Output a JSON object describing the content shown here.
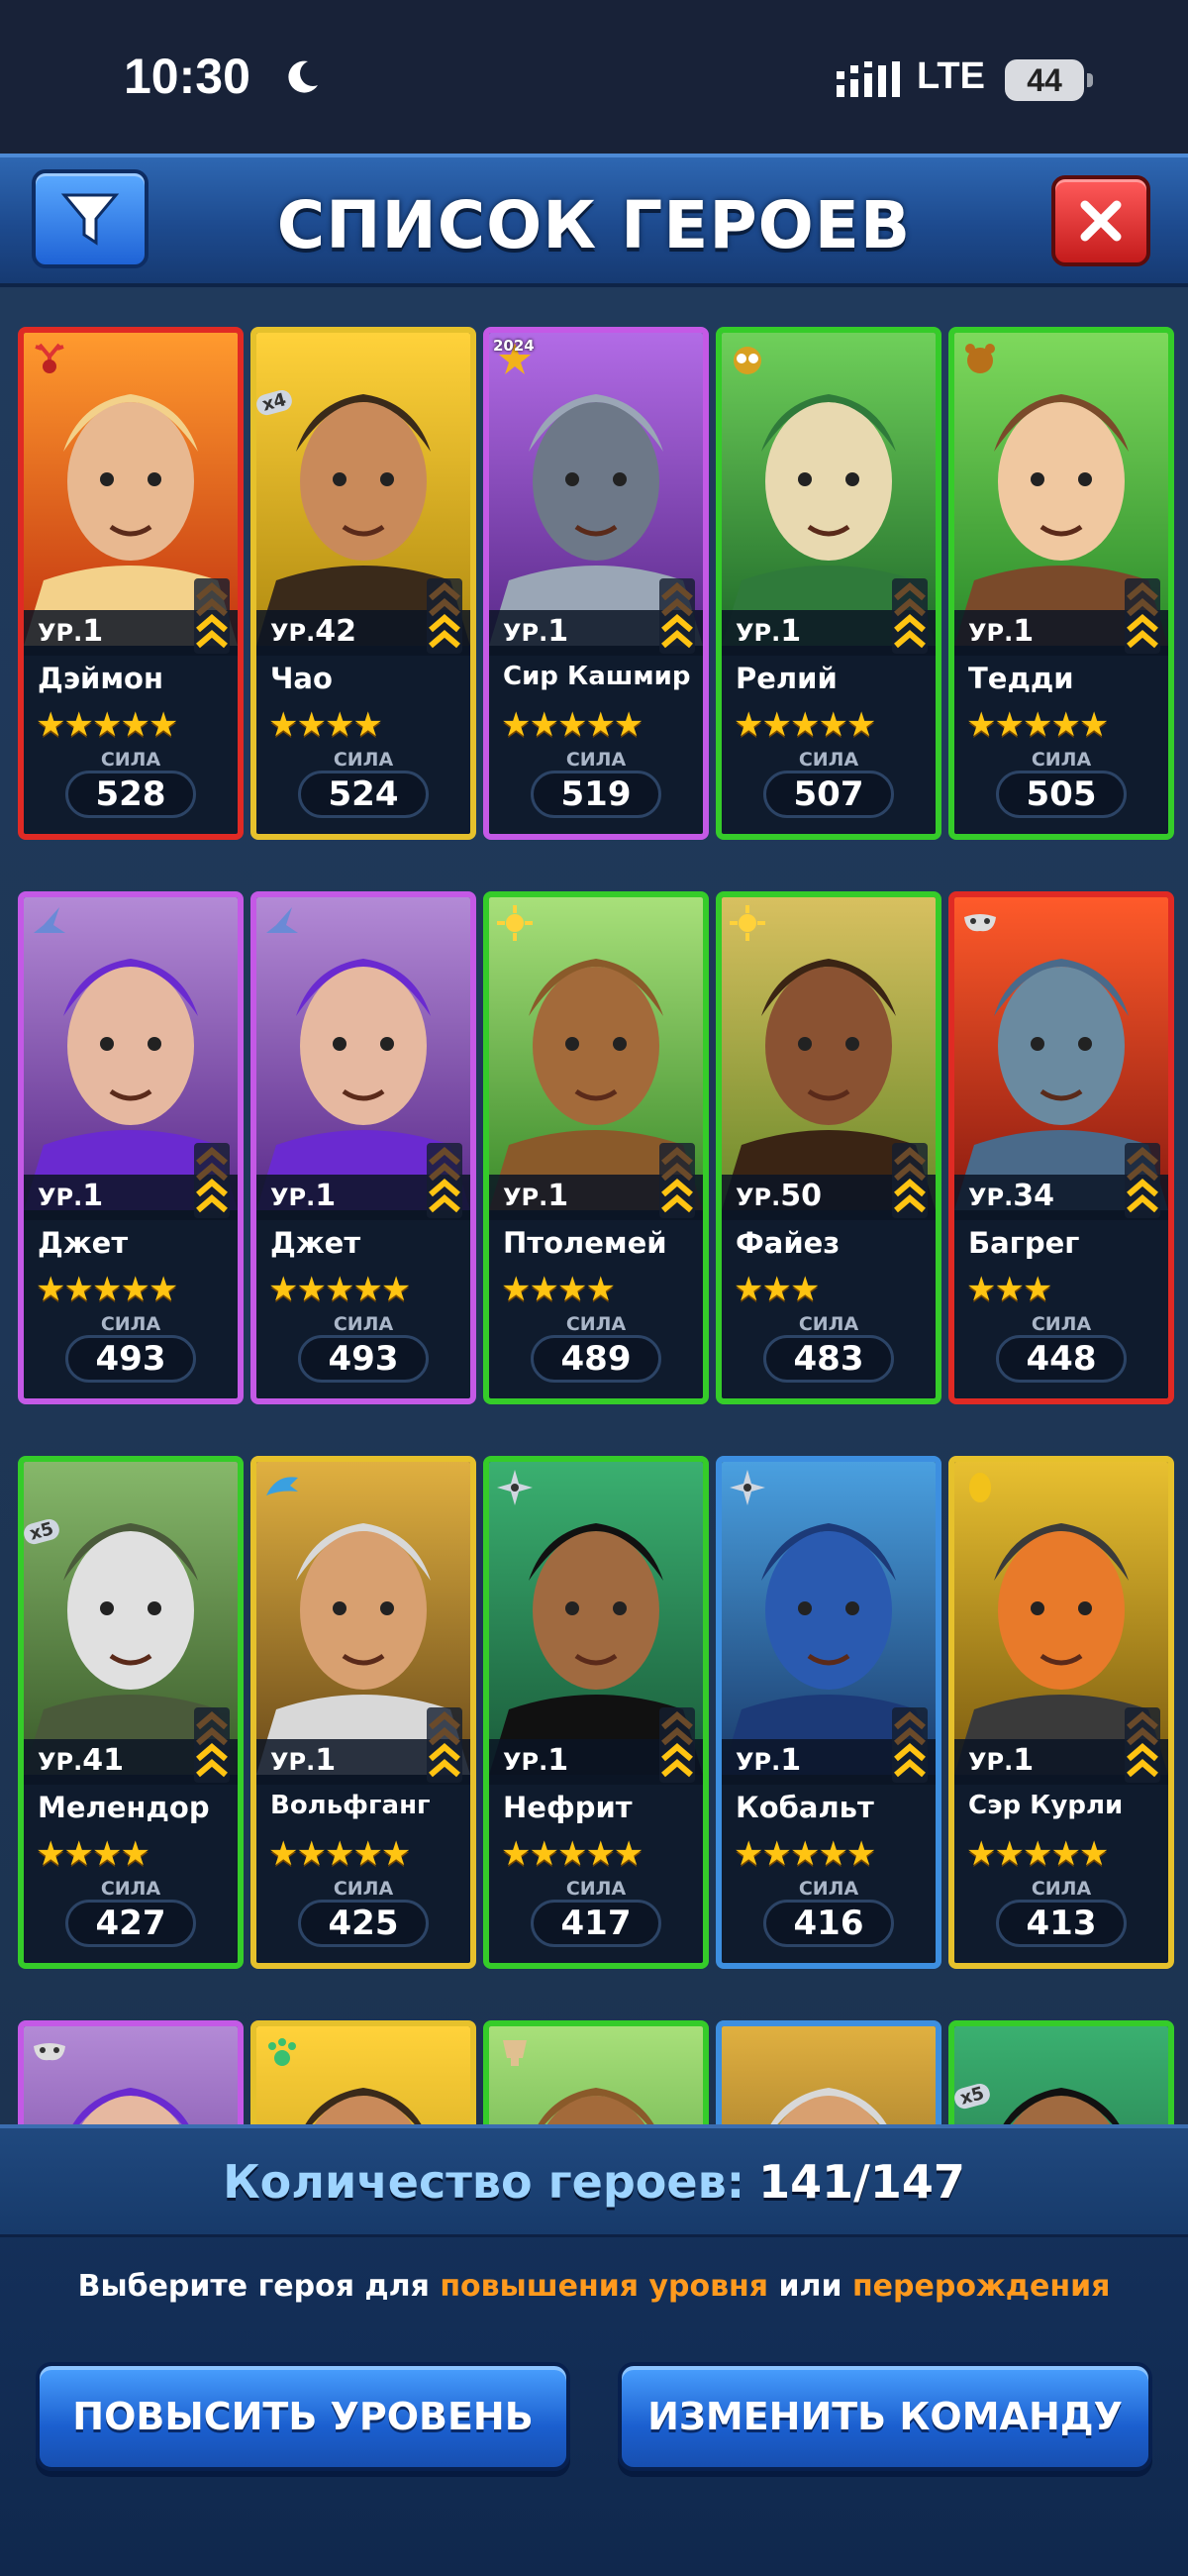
{
  "status_bar": {
    "time": "10:30",
    "network": "LTE",
    "battery": "44"
  },
  "header": {
    "title": "СПИСОК ГЕРОЕВ"
  },
  "hero_common": {
    "level_prefix": "УР.",
    "power_label": "СИЛА"
  },
  "heroes": [
    {
      "name": "Дэймон",
      "level": "1",
      "stars": 5,
      "power": "528",
      "border": "red",
      "badge_icon": "deer-antlers-icon",
      "portrait": "blonde-warrior"
    },
    {
      "name": "Чао",
      "level": "42",
      "stars": 4,
      "power": "524",
      "border": "yellow",
      "badge_icon": "dup-count-icon",
      "dup": "x4",
      "portrait": "falconer"
    },
    {
      "name": "Сир Кашмир",
      "level": "1",
      "stars": 5,
      "power": "519",
      "border": "purple",
      "badge_icon": "event-star-icon",
      "badge_text": "2024",
      "portrait": "knight"
    },
    {
      "name": "Релий",
      "level": "1",
      "stars": 5,
      "power": "507",
      "border": "green",
      "badge_icon": "owl-icon",
      "portrait": "owl"
    },
    {
      "name": "Тедди",
      "level": "1",
      "stars": 5,
      "power": "505",
      "border": "green",
      "badge_icon": "bear-icon",
      "portrait": "bear-kid"
    },
    {
      "name": "Джет",
      "level": "1",
      "stars": 5,
      "power": "493",
      "border": "purple",
      "badge_icon": "witch-hat-icon",
      "portrait": "jet"
    },
    {
      "name": "Джет",
      "level": "1",
      "stars": 5,
      "power": "493",
      "border": "purple",
      "badge_icon": "witch-hat-icon",
      "portrait": "jet"
    },
    {
      "name": "Птолемей",
      "level": "1",
      "stars": 4,
      "power": "489",
      "border": "green",
      "badge_icon": "sun-mask-icon",
      "portrait": "treeman"
    },
    {
      "name": "Файез",
      "level": "50",
      "stars": 3,
      "power": "483",
      "border": "green",
      "badge_icon": "sun-mask-icon",
      "portrait": "curly"
    },
    {
      "name": "Багрег",
      "level": "34",
      "stars": 3,
      "power": "448",
      "border": "red",
      "badge_icon": "mask-icon",
      "portrait": "fishman"
    },
    {
      "name": "Мелендор",
      "level": "41",
      "stars": 4,
      "power": "427",
      "border": "green",
      "badge_icon": "dup-count-icon",
      "dup": "x5",
      "portrait": "wizard"
    },
    {
      "name": "Вольфганг",
      "level": "1",
      "stars": 5,
      "power": "425",
      "border": "yellow",
      "badge_icon": "dragon-icon",
      "portrait": "elder-elf"
    },
    {
      "name": "Нефрит",
      "level": "1",
      "stars": 5,
      "power": "417",
      "border": "green",
      "badge_icon": "shuriken-icon",
      "portrait": "green-ninja"
    },
    {
      "name": "Кобальт",
      "level": "1",
      "stars": 5,
      "power": "416",
      "border": "blue",
      "badge_icon": "shuriken-icon",
      "portrait": "blue-ninja"
    },
    {
      "name": "Сэр Курли",
      "level": "1",
      "stars": 5,
      "power": "413",
      "border": "yellow",
      "badge_icon": "egg-mask-icon",
      "portrait": "rooster"
    }
  ],
  "partial_row": [
    {
      "border": "purple",
      "badge_icon": "mask-icon"
    },
    {
      "border": "yellow",
      "badge_icon": "paw-icon"
    },
    {
      "border": "green",
      "badge_icon": "cup-icon"
    },
    {
      "border": "blue",
      "badge_icon": "none"
    },
    {
      "border": "green",
      "badge_icon": "dup-count-icon",
      "dup": "x5"
    }
  ],
  "footer": {
    "count_label": "Количество героев:",
    "count_value": "141/147",
    "hint_part1": "Выберите героя для ",
    "hint_highlight1": "повышения уровня",
    "hint_part2": " или ",
    "hint_highlight2": "перерождения",
    "level_up_button": "ПОВЫСИТЬ УРОВЕНЬ",
    "change_team_button": "ИЗМЕНИТЬ КОМАНДУ"
  },
  "colors": {
    "red": "#e02a24",
    "yellow": "#e6c12c",
    "purple": "#c459e6",
    "green": "#35cc29",
    "blue": "#3d8fe0",
    "accent_orange": "#ff9a1e"
  }
}
